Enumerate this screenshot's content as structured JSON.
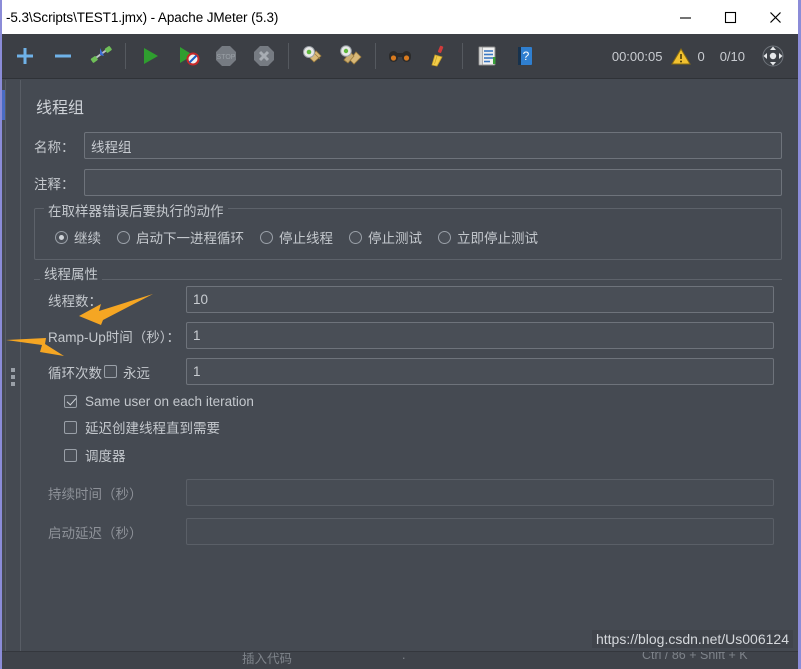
{
  "window": {
    "title": "-5.3\\Scripts\\TEST1.jmx) - Apache JMeter (5.3)",
    "minimize_label": "minimize",
    "maximize_label": "maximize",
    "close_label": "close"
  },
  "toolbar": {
    "items": [
      {
        "name": "add-icon",
        "label": "+"
      },
      {
        "name": "remove-icon",
        "label": "−"
      },
      {
        "name": "toggle-icon",
        "label": "toggle"
      },
      {
        "name": "start-icon",
        "label": "start"
      },
      {
        "name": "start-no-timers-icon",
        "label": "start-no-pauses"
      },
      {
        "name": "stop-icon",
        "label": "stop"
      },
      {
        "name": "shutdown-icon",
        "label": "shutdown"
      },
      {
        "name": "clear-icon",
        "label": "clear"
      },
      {
        "name": "clear-all-icon",
        "label": "clear-all"
      },
      {
        "name": "search-icon",
        "label": "search"
      },
      {
        "name": "reset-search-icon",
        "label": "reset-search"
      },
      {
        "name": "function-helper-icon",
        "label": "function-helper"
      },
      {
        "name": "help-icon",
        "label": "help"
      }
    ],
    "elapsed_time": "00:00:05",
    "warning_count": "0",
    "thread_count": "0/10",
    "remote_label": "remote"
  },
  "panel": {
    "title": "线程组",
    "name_label": "名称：",
    "name_value": "线程组",
    "comments_label": "注释：",
    "comments_value": "",
    "comments_placeholder": ""
  },
  "on_error": {
    "title": "在取样器错误后要执行的动作",
    "options": [
      {
        "label": "继续",
        "selected": true
      },
      {
        "label": "启动下一进程循环",
        "selected": false
      },
      {
        "label": "停止线程",
        "selected": false
      },
      {
        "label": "停止测试",
        "selected": false
      },
      {
        "label": "立即停止测试",
        "selected": false
      }
    ]
  },
  "thread_properties": {
    "title": "线程属性",
    "num_threads_label": "线程数：",
    "num_threads_value": "10",
    "ramp_up_label": "Ramp-Up时间（秒）：",
    "ramp_up_value": "1",
    "loop_count_label": "循环次数",
    "forever_label": "永远",
    "forever_checked": false,
    "loop_count_value": "1",
    "same_user_label": "Same user on each iteration",
    "same_user_checked": true,
    "delay_thread_label": "延迟创建线程直到需要",
    "delay_thread_checked": false,
    "scheduler_label": "调度器",
    "scheduler_checked": false,
    "duration_label": "持续时间（秒）",
    "duration_value": "",
    "startup_delay_label": "启动延迟（秒）",
    "startup_delay_value": ""
  },
  "annotations": {
    "arrow_color": "#F5A623",
    "arrow1_target": "线程数",
    "arrow2_target": "Ramp-Up时间"
  },
  "watermark": {
    "text": "https://blog.csdn.net/Us006124"
  },
  "status_strip": {
    "col1": "插入代码",
    "col2": ".",
    "col3": "Ctrl / 86 + Shift + K"
  },
  "colors": {
    "window_chrome": "#ffffff",
    "toolbar_bg": "#3c3f45",
    "panel_bg": "#454a52",
    "field_bg": "#494e56",
    "text": "#c4c8cd",
    "accent_border": "#8b8cd8",
    "selection": "#4a6cc4"
  }
}
